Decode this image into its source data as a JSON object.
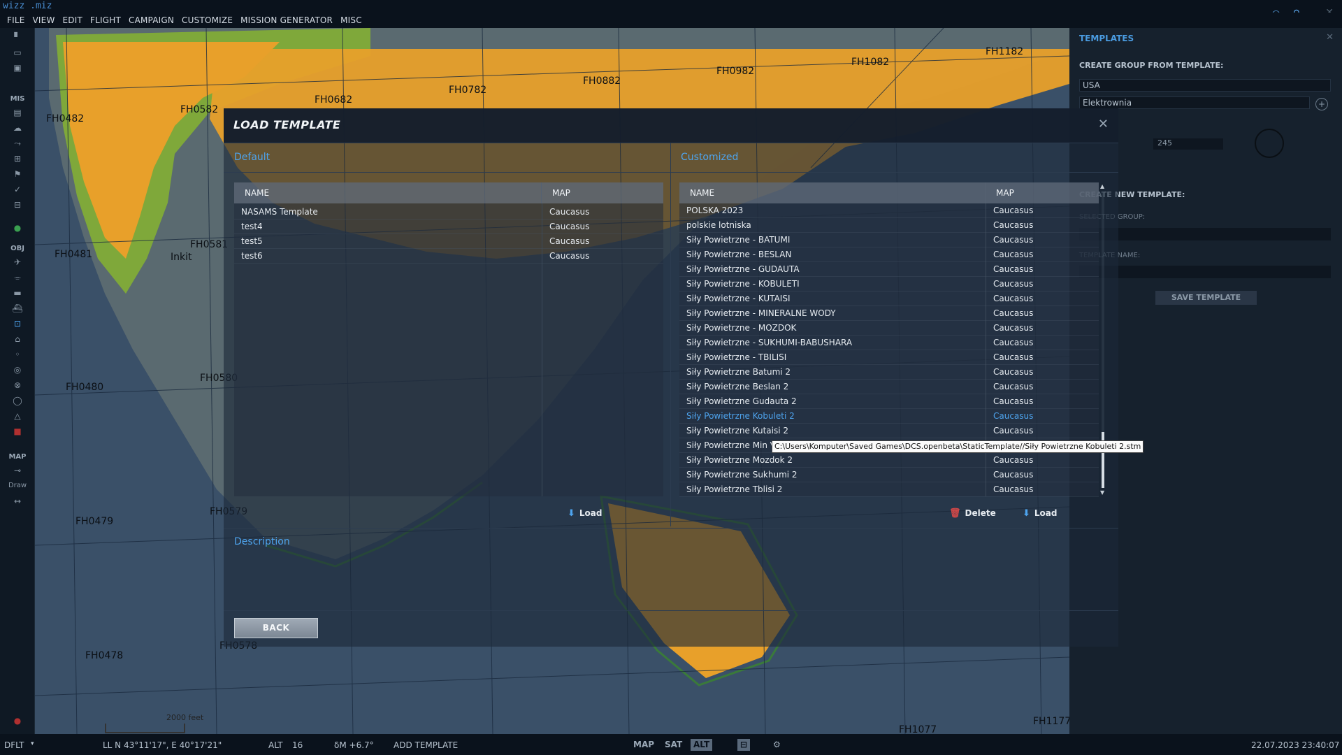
{
  "app": {
    "title": "wizz .miz"
  },
  "menu": [
    "FILE",
    "VIEW",
    "EDIT",
    "FLIGHT",
    "CAMPAIGN",
    "CUSTOMIZE",
    "MISSION GENERATOR",
    "MISC"
  ],
  "left_toolbar": {
    "labels": [
      "MIS",
      "OBJ",
      "MAP"
    ],
    "draw_label": "Draw"
  },
  "map": {
    "grid_labels": [
      "FH1182",
      "FH1082",
      "FH0982",
      "FH0882",
      "FH0782",
      "FH0682",
      "FH0582",
      "FH0482",
      "FH0481",
      "FH0581",
      "FH0480",
      "FH0580",
      "FH0479",
      "FH0579",
      "FH0478",
      "FH0578",
      "FH1177",
      "FH1077"
    ],
    "place_label": "Inkit",
    "scale_label": "2000 feet"
  },
  "templates_panel": {
    "title": "TEMPLATES",
    "create_from_label": "CREATE GROUP FROM TEMPLATE:",
    "country": "USA",
    "template": "Elektrownia",
    "heading": "245",
    "new_template_label": "CREATE NEW TEMPLATE:",
    "selected_group_label": "SELECTED GROUP:",
    "template_name_label": "TEMPLATE NAME:",
    "save_label": "SAVE TEMPLATE"
  },
  "modal": {
    "title": "LOAD TEMPLATE",
    "default": {
      "title": "Default",
      "headers": [
        "NAME",
        "MAP"
      ],
      "rows": [
        [
          "NASAMS Template",
          "Caucasus"
        ],
        [
          "test4",
          "Caucasus"
        ],
        [
          "test5",
          "Caucasus"
        ],
        [
          "test6",
          "Caucasus"
        ]
      ],
      "load_label": "Load"
    },
    "customized": {
      "title": "Customized",
      "headers": [
        "NAME",
        "MAP"
      ],
      "rows": [
        [
          "POLSKA 2023",
          "Caucasus"
        ],
        [
          "polskie lotniska",
          "Caucasus"
        ],
        [
          "Siły Powietrzne - BATUMI",
          "Caucasus"
        ],
        [
          "Siły Powietrzne - BESLAN",
          "Caucasus"
        ],
        [
          "Siły Powietrzne - GUDAUTA",
          "Caucasus"
        ],
        [
          "Siły Powietrzne - KOBULETI",
          "Caucasus"
        ],
        [
          "Siły Powietrzne - KUTAISI",
          "Caucasus"
        ],
        [
          "Siły Powietrzne - MINERALNE WODY",
          "Caucasus"
        ],
        [
          "Siły Powietrzne - MOZDOK",
          "Caucasus"
        ],
        [
          "Siły Powietrzne - SUKHUMI-BABUSHARA",
          "Caucasus"
        ],
        [
          "Siły Powietrzne - TBILISI",
          "Caucasus"
        ],
        [
          "Siły Powietrzne Batumi 2",
          "Caucasus"
        ],
        [
          "Siły Powietrzne Beslan 2",
          "Caucasus"
        ],
        [
          "Siły Powietrzne Gudauta 2",
          "Caucasus"
        ],
        [
          "Siły Powietrzne Kobuleti 2",
          "Caucasus"
        ],
        [
          "Siły Powietrzne Kutaisi 2",
          "Caucasus"
        ],
        [
          "Siły Powietrzne Min Vo",
          ""
        ],
        [
          "Siły Powietrzne Mozdok 2",
          "Caucasus"
        ],
        [
          "Siły Powietrzne Sukhumi 2",
          "Caucasus"
        ],
        [
          "Siły Powietrzne Tblisi 2",
          "Caucasus"
        ]
      ],
      "selected_row_index": 14,
      "delete_label": "Delete",
      "load_label": "Load"
    },
    "description_title": "Description",
    "back_label": "BACK",
    "tooltip": "C:\\Users\\Komputer\\Saved Games\\DCS.openbeta\\StaticTemplate//Siły Powietrzne Kobuleti 2.stm"
  },
  "statusbar": {
    "profile": "DFLT",
    "coords": "LL  N 43°11'17\", E 40°17'21\"",
    "alt_label": "ALT",
    "alt_value": "16",
    "magvar": "δM  +6.7°",
    "mode": "ADD TEMPLATE",
    "view_buttons": [
      "MAP",
      "SAT",
      "ALT"
    ],
    "datetime": "22.07.2023 23:40:07"
  },
  "colors": {
    "accent": "#4ea4ee",
    "land": "#e8a02a",
    "sea": "#3a5068",
    "forest": "#7fa83a"
  }
}
